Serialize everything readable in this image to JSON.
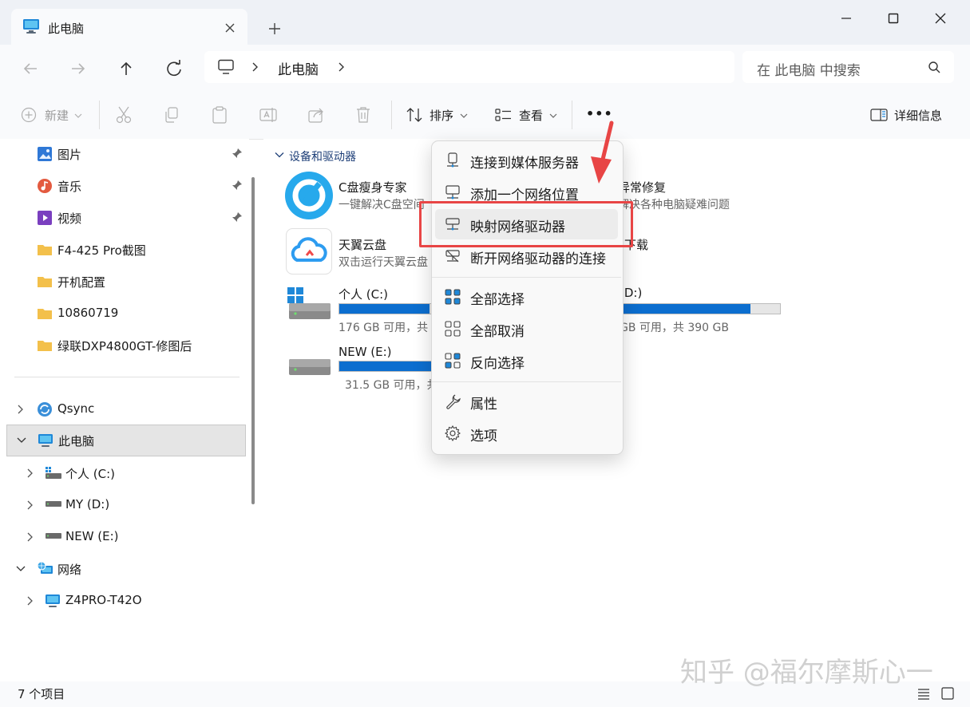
{
  "window": {
    "tab_title": "此电脑",
    "new_tab": "+",
    "controls": [
      "minimize",
      "maximize",
      "close"
    ]
  },
  "nav": {
    "breadcrumb": [
      "此电脑"
    ],
    "search_placeholder": "在 此电脑 中搜索"
  },
  "toolbar": {
    "new_label": "新建",
    "sort_label": "排序",
    "view_label": "查看",
    "more_label": "•••",
    "details_label": "详细信息"
  },
  "sidebar": {
    "pinned": [
      {
        "label": "图片",
        "icon": "pictures-icon"
      },
      {
        "label": "音乐",
        "icon": "music-icon"
      },
      {
        "label": "视频",
        "icon": "video-icon"
      },
      {
        "label": "F4-425 Pro截图",
        "icon": "folder-icon"
      },
      {
        "label": "开机配置",
        "icon": "folder-icon"
      },
      {
        "label": "10860719",
        "icon": "folder-icon"
      },
      {
        "label": "绿联DXP4800GT-修图后",
        "icon": "folder-icon"
      }
    ],
    "tree": [
      {
        "label": "Qsync"
      },
      {
        "label": "此电脑",
        "selected": true
      },
      {
        "label": "个人 (C:)"
      },
      {
        "label": "MY (D:)"
      },
      {
        "label": "NEW (E:)"
      },
      {
        "label": "网络"
      },
      {
        "label": "Z4PRO-T42O"
      }
    ]
  },
  "content": {
    "group_title": "设备和驱动器",
    "apps": [
      {
        "name": "C盘瘦身专家",
        "desc": "一键解决C盘空间"
      },
      {
        "name": "异常修复",
        "desc": "解决各种电脑疑难问题"
      },
      {
        "name": "天翼云盘",
        "desc": "双击运行天翼云盘"
      },
      {
        "name": "下载"
      }
    ],
    "drives": [
      {
        "name": "个人 (C:)",
        "info": "176 GB 可用，共",
        "used_fraction": 0.82
      },
      {
        "name": "(D:)",
        "info": "GB 可用，共 390 GB",
        "used_fraction": 0.86
      },
      {
        "name": "NEW (E:)",
        "info": "31.5 GB 可用，共",
        "used_fraction": 0.9
      }
    ]
  },
  "menu": {
    "items": [
      {
        "label": "连接到媒体服务器",
        "icon": "media-server-icon"
      },
      {
        "label": "添加一个网络位置",
        "icon": "network-location-icon"
      },
      {
        "label": "映射网络驱动器",
        "icon": "map-drive-icon",
        "highlighted": true
      },
      {
        "label": "断开网络驱动器的连接",
        "icon": "disconnect-drive-icon"
      },
      {
        "label": "全部选择",
        "icon": "select-all-icon"
      },
      {
        "label": "全部取消",
        "icon": "select-none-icon"
      },
      {
        "label": "反向选择",
        "icon": "invert-selection-icon"
      },
      {
        "label": "属性",
        "icon": "wrench-icon"
      },
      {
        "label": "选项",
        "icon": "gear-icon"
      }
    ]
  },
  "status": {
    "item_count": "7 个项目"
  },
  "watermark": "知乎 @福尔摩斯心一",
  "colors": {
    "accent": "#0c6ecf",
    "highlight_red": "#e84545",
    "folder_yellow": "#f3c04b"
  }
}
